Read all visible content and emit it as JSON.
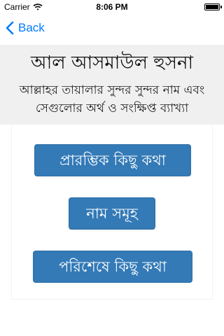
{
  "status_bar": {
    "carrier": "Carrier",
    "time": "8:06 PM",
    "battery_level": 1.0
  },
  "nav": {
    "back_label": "Back"
  },
  "header": {
    "title": "আল আসমাউল হুসনা",
    "subtitle": "আল্লাহর তায়ালার সুন্দর সুন্দর নাম এবং সেগুলোর অর্থ ও সংক্ষিপ্ত ব্যাখ্যা"
  },
  "menu": {
    "intro_label": "প্রারম্ভিক কিছু কথা",
    "names_label": "নাম সমূহ",
    "outro_label": "পরিশেষে কিছু কথা"
  },
  "colors": {
    "button_bg": "#337ab7",
    "back_tint": "#007aff",
    "header_bg": "#f0f0f0"
  },
  "icons": {
    "wifi": "wifi-icon",
    "battery": "battery-icon",
    "back": "chevron-left-icon"
  }
}
